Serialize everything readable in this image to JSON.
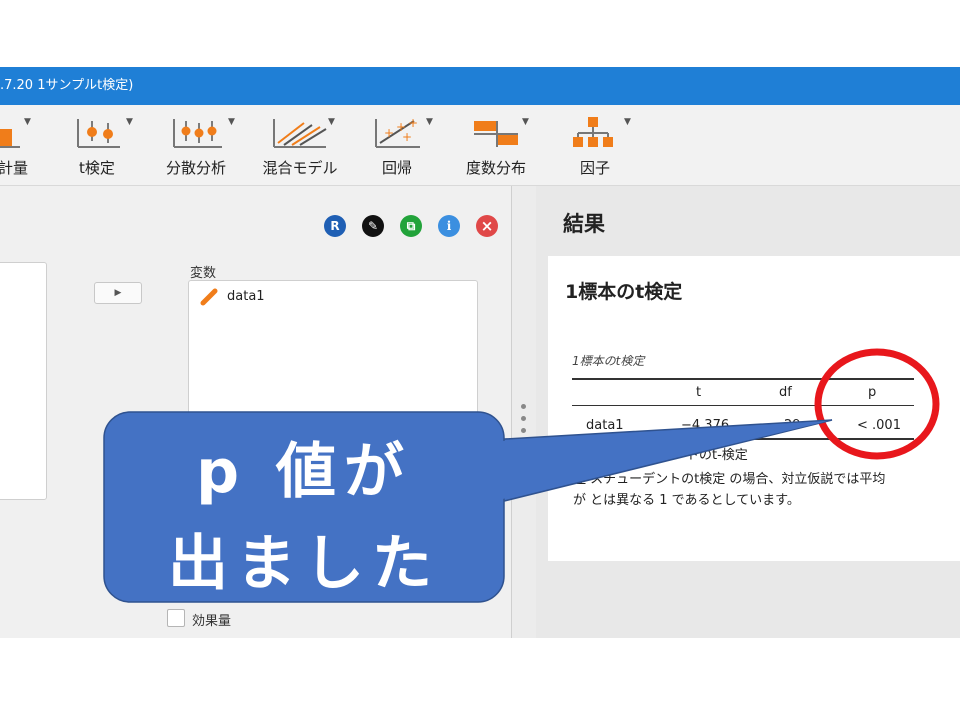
{
  "window": {
    "title": ".7.20 1サンプルt検定)"
  },
  "toolbar": {
    "items": [
      {
        "label": "計量",
        "icon": "descriptives-icon"
      },
      {
        "label": "t検定",
        "icon": "t-test-icon"
      },
      {
        "label": "分散分析",
        "icon": "anova-icon"
      },
      {
        "label": "混合モデル",
        "icon": "mixed-model-icon"
      },
      {
        "label": "回帰",
        "icon": "regression-icon"
      },
      {
        "label": "度数分布",
        "icon": "frequencies-icon"
      },
      {
        "label": "因子",
        "icon": "factor-icon"
      }
    ]
  },
  "options_panel": {
    "buttons": [
      {
        "glyph": "R",
        "icon": "r-syntax-icon",
        "color": "#1f5fb4"
      },
      {
        "glyph": "✎",
        "icon": "edit-icon",
        "color": "#111111"
      },
      {
        "glyph": "⧉",
        "icon": "copy-icon",
        "color": "#22a33a"
      },
      {
        "glyph": "i",
        "icon": "info-icon",
        "color": "#3b8fe0"
      },
      {
        "glyph": "×",
        "icon": "close-icon",
        "color": "#e04848"
      }
    ],
    "move_arrow": "▶",
    "variables_label": "変数",
    "variables": [
      "data1"
    ],
    "effect_size_label": "効果量"
  },
  "results": {
    "header": "結果",
    "title": "1標本のt検定",
    "table_caption": "1標本のt検定",
    "columns": [
      "t",
      "df",
      "p"
    ],
    "row": {
      "name": "data1",
      "t": "−4.376",
      "df": "29",
      "p": "< .001"
    },
    "note1": "ントのt-検定",
    "note2": "注 スチューデントのt検定 の場合、対立仮説では平均",
    "note3": "が とは異なる 1 であるとしています。"
  },
  "callout": {
    "line1": "p 値が",
    "line2": "出ました",
    "fill": "#4472c4",
    "circle_color": "#e8171c"
  }
}
